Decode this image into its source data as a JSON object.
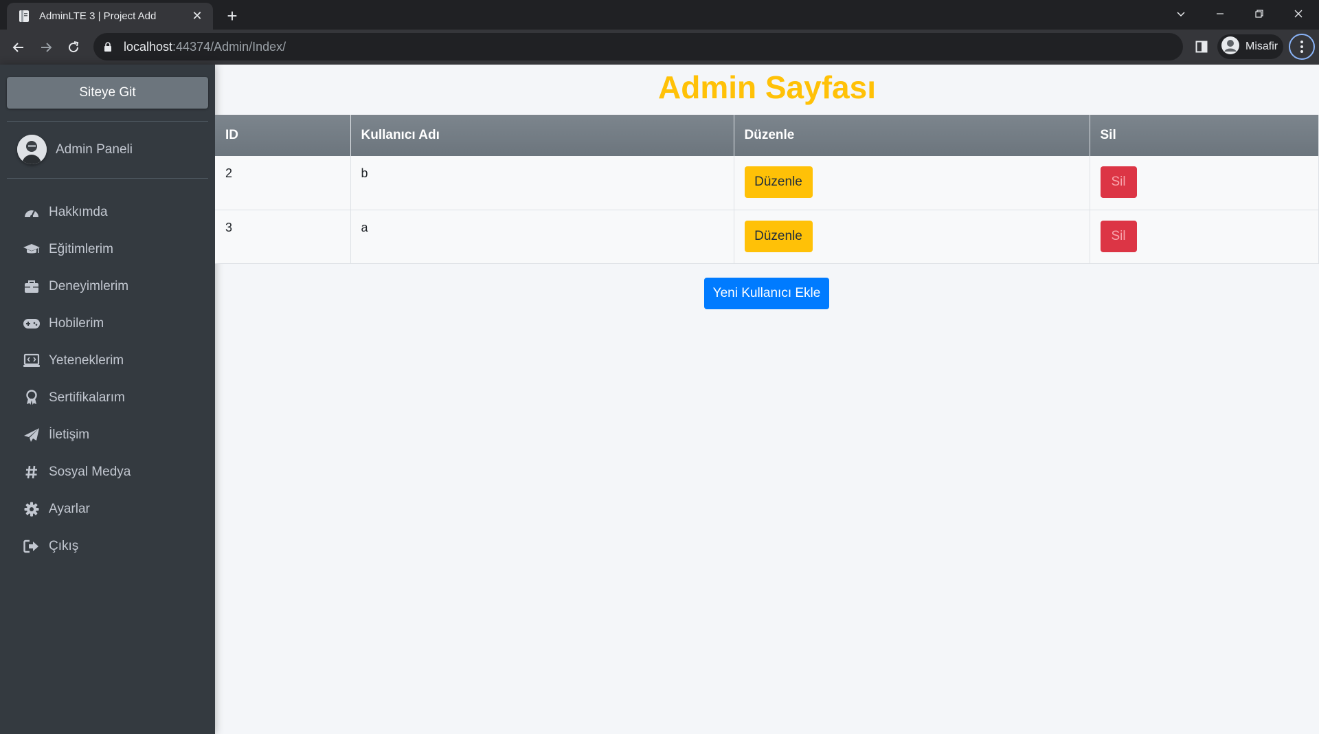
{
  "browser": {
    "tab_title": "AdminLTE 3 | Project Add",
    "url_host": "localhost",
    "url_rest": ":44374/Admin/Index/",
    "profile_label": "Misafir"
  },
  "sidebar": {
    "site_button": "Siteye Git",
    "user_name": "Admin Paneli",
    "items": [
      {
        "label": "Hakkımda",
        "icon": "tachometer-icon"
      },
      {
        "label": "Eğitimlerim",
        "icon": "graduation-cap-icon"
      },
      {
        "label": "Deneyimlerim",
        "icon": "briefcase-icon"
      },
      {
        "label": "Hobilerim",
        "icon": "gamepad-icon"
      },
      {
        "label": "Yeteneklerim",
        "icon": "laptop-code-icon"
      },
      {
        "label": "Sertifikalarım",
        "icon": "award-icon"
      },
      {
        "label": "İletişim",
        "icon": "paper-plane-icon"
      },
      {
        "label": "Sosyal Medya",
        "icon": "hashtag-icon"
      },
      {
        "label": "Ayarlar",
        "icon": "cog-icon"
      },
      {
        "label": "Çıkış",
        "icon": "sign-out-icon"
      }
    ]
  },
  "main": {
    "title": "Admin Sayfası",
    "table": {
      "headers": [
        "ID",
        "Kullanıcı Adı",
        "Düzenle",
        "Sil"
      ],
      "rows": [
        {
          "id": "2",
          "username": "b",
          "edit_label": "Düzenle",
          "delete_label": "Sil"
        },
        {
          "id": "3",
          "username": "a",
          "edit_label": "Düzenle",
          "delete_label": "Sil"
        }
      ]
    },
    "add_button": "Yeni Kullanıcı Ekle"
  },
  "colors": {
    "title": "#ffc107",
    "sidebar_bg": "#343a40",
    "primary": "#007bff",
    "warning": "#ffc107",
    "danger": "#dc3545"
  }
}
